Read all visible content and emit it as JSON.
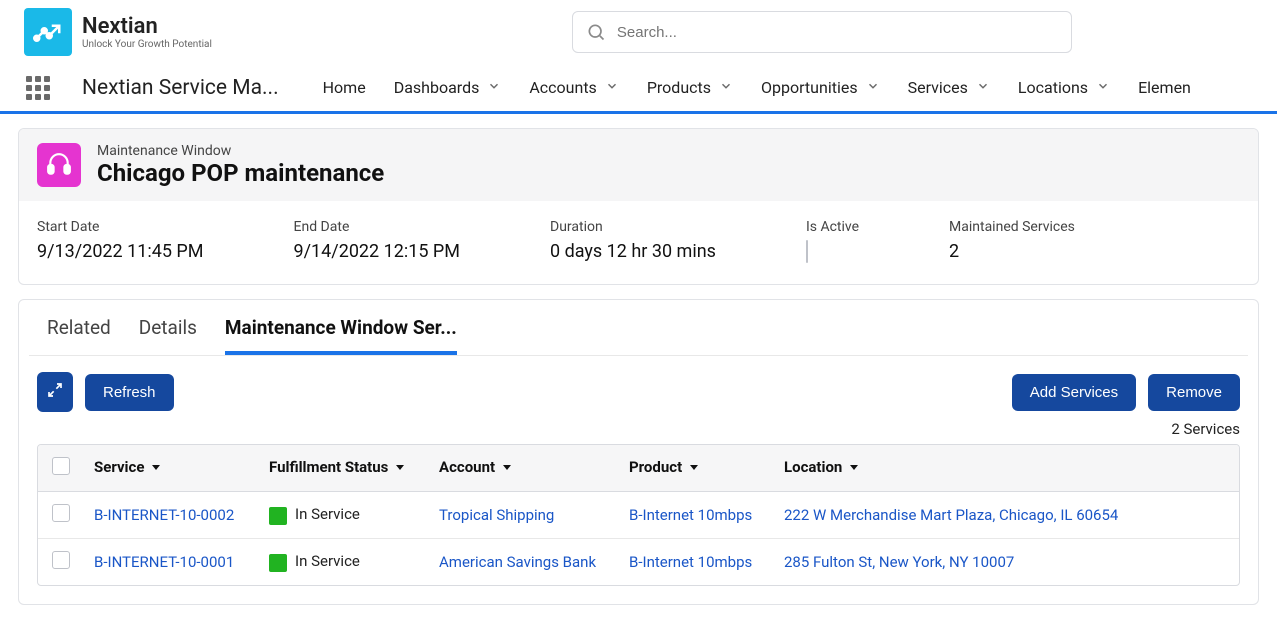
{
  "brand": {
    "name": "Nextian",
    "tagline": "Unlock Your Growth Potential"
  },
  "search": {
    "placeholder": "Search..."
  },
  "app_title": "Nextian Service Ma...",
  "nav": [
    {
      "label": "Home",
      "has_menu": false
    },
    {
      "label": "Dashboards",
      "has_menu": true
    },
    {
      "label": "Accounts",
      "has_menu": true
    },
    {
      "label": "Products",
      "has_menu": true
    },
    {
      "label": "Opportunities",
      "has_menu": true
    },
    {
      "label": "Services",
      "has_menu": true
    },
    {
      "label": "Locations",
      "has_menu": true
    },
    {
      "label": "Elemen",
      "has_menu": false
    }
  ],
  "record": {
    "object_label": "Maintenance Window",
    "name": "Chicago POP maintenance",
    "fields": {
      "start_label": "Start Date",
      "start_value": "9/13/2022 11:45 PM",
      "end_label": "End Date",
      "end_value": "9/14/2022 12:15 PM",
      "duration_label": "Duration",
      "duration_value": "0 days 12 hr 30 mins",
      "active_label": "Is Active",
      "maintained_label": "Maintained Services",
      "maintained_value": "2"
    }
  },
  "tabs": [
    {
      "label": "Related",
      "active": false
    },
    {
      "label": "Details",
      "active": false
    },
    {
      "label": "Maintenance Window Ser...",
      "active": true
    }
  ],
  "buttons": {
    "refresh": "Refresh",
    "add": "Add Services",
    "remove": "Remove"
  },
  "count_text": "2 Services",
  "table": {
    "headers": [
      "Service",
      "Fulfillment Status",
      "Account",
      "Product",
      "Location"
    ],
    "rows": [
      {
        "service": "B-INTERNET-10-0002",
        "status": "In Service",
        "account": "Tropical Shipping",
        "product": "B-Internet 10mbps",
        "location": "222 W Merchandise Mart Plaza, Chicago, IL 60654"
      },
      {
        "service": "B-INTERNET-10-0001",
        "status": "In Service",
        "account": "American Savings Bank",
        "product": "B-Internet 10mbps",
        "location": "285 Fulton St, New York, NY 10007"
      }
    ]
  }
}
